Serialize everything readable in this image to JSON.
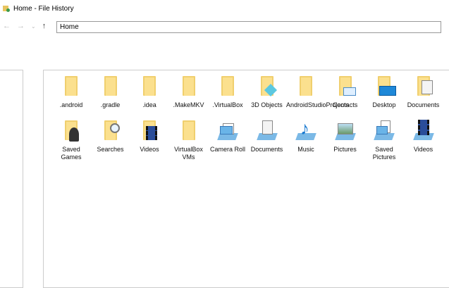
{
  "window": {
    "title": "Home - File History"
  },
  "nav": {
    "back": "←",
    "forward": "→",
    "recent": "⌄",
    "up": "↑"
  },
  "address": {
    "value": "Home"
  },
  "items": [
    {
      "label": ".android",
      "icon": "folder-icon"
    },
    {
      "label": ".gradle",
      "icon": "folder-icon"
    },
    {
      "label": ".idea",
      "icon": "folder-icon"
    },
    {
      "label": ".MakeMKV",
      "icon": "folder-icon"
    },
    {
      "label": ".VirtualBox",
      "icon": "folder-icon"
    },
    {
      "label": "3D Objects",
      "icon": "3d-objects-folder-icon"
    },
    {
      "label": "AndroidStudioProjects",
      "icon": "folder-icon"
    },
    {
      "label": "Contacts",
      "icon": "contacts-folder-icon"
    },
    {
      "label": "Desktop",
      "icon": "desktop-folder-icon"
    },
    {
      "label": "Documents",
      "icon": "documents-folder-icon"
    },
    {
      "label": "Saved Games",
      "icon": "saved-games-folder-icon"
    },
    {
      "label": "Searches",
      "icon": "searches-folder-icon"
    },
    {
      "label": "Videos",
      "icon": "videos-folder-icon"
    },
    {
      "label": "VirtualBox VMs",
      "icon": "folder-icon"
    },
    {
      "label": "Camera Roll",
      "icon": "camera-roll-library-icon"
    },
    {
      "label": "Documents",
      "icon": "documents-library-icon"
    },
    {
      "label": "Music",
      "icon": "music-library-icon"
    },
    {
      "label": "Pictures",
      "icon": "pictures-library-icon"
    },
    {
      "label": "Saved Pictures",
      "icon": "saved-pictures-library-icon"
    },
    {
      "label": "Videos",
      "icon": "videos-library-icon"
    }
  ]
}
